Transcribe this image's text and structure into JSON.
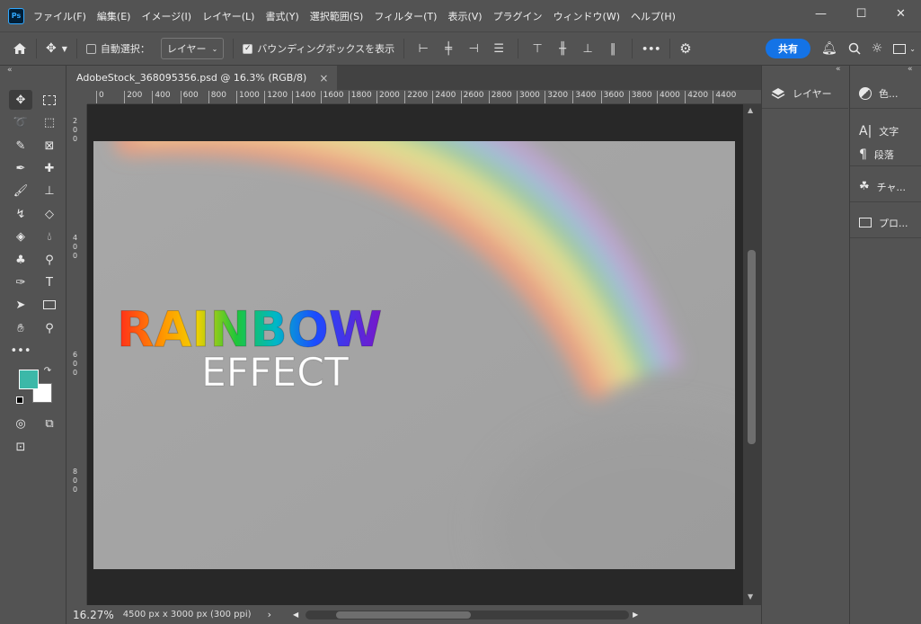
{
  "menubar": {
    "logo": "Ps",
    "items": [
      "ファイル(F)",
      "編集(E)",
      "イメージ(I)",
      "レイヤー(L)",
      "書式(Y)",
      "選択範囲(S)",
      "フィルター(T)",
      "表示(V)",
      "プラグイン",
      "ウィンドウ(W)",
      "ヘルプ(H)"
    ],
    "window_controls": {
      "minimize": "—",
      "maximize": "☐",
      "close": "✕"
    }
  },
  "options": {
    "auto_select_label": "自動選択：",
    "auto_select_target": "レイヤー",
    "bounding_box_label": "バウンディングボックスを表示",
    "more": "•••",
    "share": "共有"
  },
  "document": {
    "tab_title": "AdobeStock_368095356.psd @ 16.3% (RGB/8)",
    "tab_close": "×",
    "ruler_h": [
      "0",
      "200",
      "400",
      "600",
      "800",
      "1000",
      "1200",
      "1400",
      "1600",
      "1800",
      "2000",
      "2200",
      "2400",
      "2600",
      "2800",
      "3000",
      "3200",
      "3400",
      "3600",
      "3800",
      "4000",
      "4200",
      "4400"
    ],
    "ruler_v": [
      "2",
      "0",
      "0",
      "4",
      "0",
      "0",
      "6",
      "0",
      "0",
      "8",
      "0",
      "0"
    ],
    "art_title": "RAINBOW",
    "art_subtitle": "EFFECT",
    "zoom": "16.27%",
    "dimensions": "4500 px x 3000 px (300 ppi)"
  },
  "colors": {
    "foreground": "#3cb8a8",
    "background": "#ffffff",
    "accent": "#1473e6"
  },
  "panels": {
    "layers": "レイヤー",
    "color": "色...",
    "character": "文字",
    "paragraph": "段落",
    "channels": "チャ...",
    "properties": "プロ..."
  }
}
